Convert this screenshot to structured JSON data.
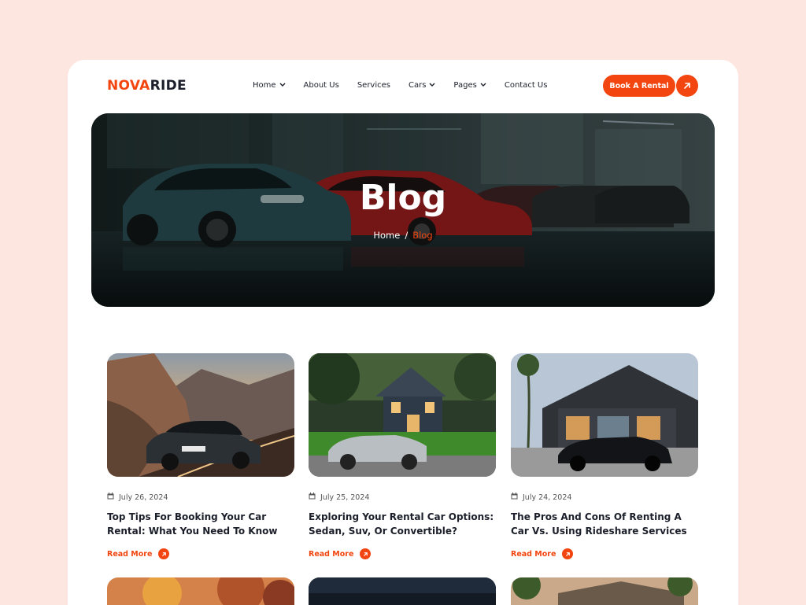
{
  "brand": {
    "part1": "NOVA",
    "part2": "RIDE"
  },
  "nav": [
    {
      "label": "Home",
      "dropdown": true
    },
    {
      "label": "About Us",
      "dropdown": false
    },
    {
      "label": "Services",
      "dropdown": false
    },
    {
      "label": "Cars",
      "dropdown": true
    },
    {
      "label": "Pages",
      "dropdown": true
    },
    {
      "label": "Contact Us",
      "dropdown": false
    }
  ],
  "cta": {
    "label": "Book A Rental"
  },
  "hero": {
    "title": "Blog",
    "breadcrumb_home": "Home",
    "breadcrumb_sep": "/",
    "breadcrumb_current": "Blog"
  },
  "posts": [
    {
      "date": "July 26, 2024",
      "title": "Top Tips For Booking Your Car Rental: What You Need To Know",
      "read_more": "Read More"
    },
    {
      "date": "July 25, 2024",
      "title": "Exploring Your Rental Car Options: Sedan, Suv, Or Convertible?",
      "read_more": "Read More"
    },
    {
      "date": "July 24, 2024",
      "title": "The Pros And Cons Of Renting A Car Vs. Using Rideshare Services",
      "read_more": "Read More"
    }
  ],
  "colors": {
    "accent": "#f2450f",
    "page_bg": "#fde6df",
    "dark": "#1b1f2a"
  }
}
